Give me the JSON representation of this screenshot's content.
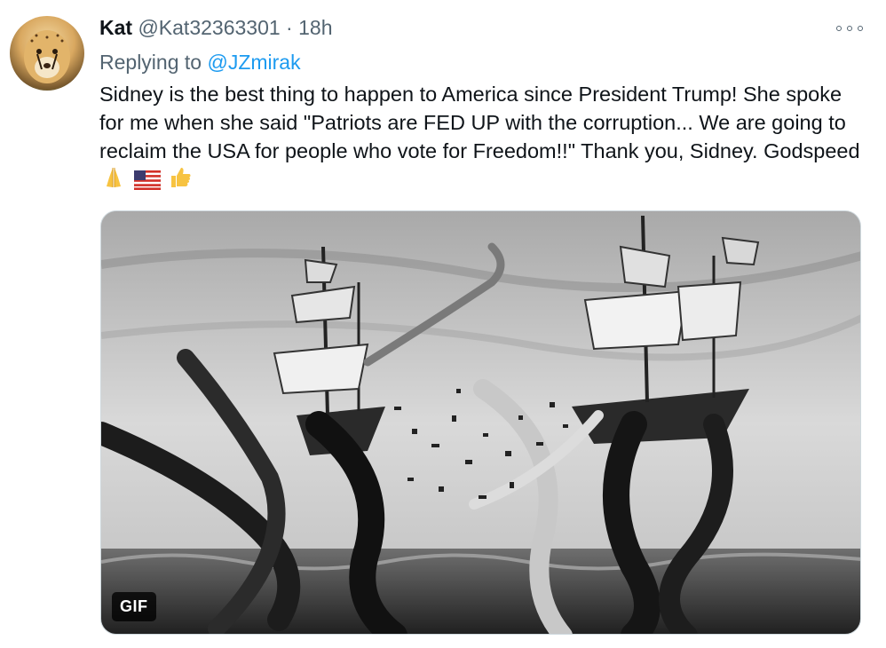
{
  "tweet": {
    "display_name": "Kat",
    "handle": "@Kat32363301",
    "separator": "·",
    "time": "18h",
    "replying_prefix": "Replying to",
    "replying_to": "@JZmirak",
    "text": "Sidney is the best thing to happen to America since President Trump! She spoke for me when she said \"Patriots are FED UP with the corruption... We are going to reclaim the USA for people who vote for Freedom!!\" Thank you, Sidney. Godspeed",
    "emojis": [
      "folded-hands",
      "us-flag",
      "thumbs-up"
    ],
    "media": {
      "type": "gif",
      "badge": "GIF"
    }
  },
  "colors": {
    "link": "#1d9bf0",
    "secondary_text": "#536471",
    "primary_text": "#0f1419"
  }
}
